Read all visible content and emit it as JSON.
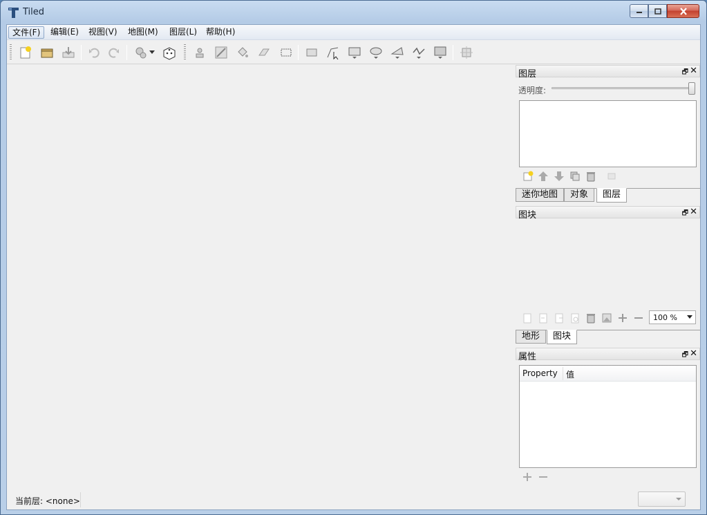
{
  "window": {
    "title": "Tiled"
  },
  "menubar": {
    "items": [
      {
        "label": "文件(F)"
      },
      {
        "label": "编辑(E)"
      },
      {
        "label": "视图(V)"
      },
      {
        "label": "地图(M)"
      },
      {
        "label": "图层(L)"
      },
      {
        "label": "帮助(H)"
      }
    ]
  },
  "toolbar": {
    "icons": [
      "new-map-icon",
      "open-icon",
      "save-icon",
      "undo-icon",
      "redo-icon",
      "commands-icon",
      "random-dice-icon",
      "stamp-brush-icon",
      "terrain-brush-icon",
      "bucket-fill-icon",
      "eraser-icon",
      "rect-select-icon",
      "select-objects-icon",
      "edit-polygons-icon",
      "insert-rectangle-icon",
      "insert-ellipse-icon",
      "insert-polygon-icon",
      "insert-polyline-icon",
      "insert-tile-icon",
      "world-icon"
    ]
  },
  "layers_panel": {
    "title": "图层",
    "opacity_label": "透明度:",
    "opacity": 1.0
  },
  "tabs_top": [
    "迷你地图",
    "对象",
    "图层"
  ],
  "tileset_panel": {
    "title": "图块",
    "zoom_value": "100 %"
  },
  "tabs_mid": [
    "地形",
    "图块"
  ],
  "properties_panel": {
    "title": "属性",
    "col_property": "Property",
    "col_value": "值"
  },
  "statusbar": {
    "current_layer": "当前层: <none>"
  },
  "colors": {
    "titlebar": "#c9dcf1",
    "close_button": "#c3412f",
    "background": "#f0f0f0"
  }
}
